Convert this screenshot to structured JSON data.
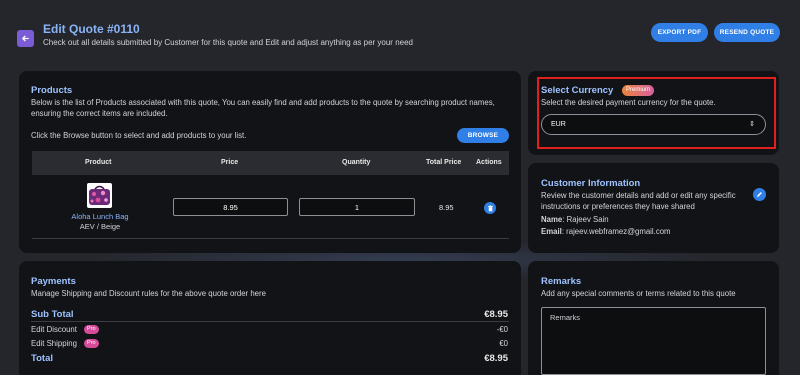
{
  "header": {
    "title": "Edit Quote #0110",
    "subtitle": "Check out all details submitted by Customer for this quote and Edit and adjust anything as per your need",
    "export_label": "EXPORT PDF",
    "resend_label": "RESEND QUOTE"
  },
  "products": {
    "title": "Products",
    "description": "Below is the list of Products associated with this quote, You can easily find and add products to the quote by searching product names, ensuring the correct items are included.",
    "browse_hint": "Click the Browse button to select and add products to your list.",
    "browse_label": "BROWSE",
    "columns": [
      "Product",
      "Price",
      "Quantity",
      "Total Price",
      "Actions"
    ],
    "rows": [
      {
        "name": "Aloha Lunch Bag",
        "variant": "AEV / Beige",
        "price": "8.95",
        "quantity": "1",
        "total": "8.95"
      }
    ]
  },
  "currency": {
    "title": "Select Currency",
    "badge": "Premium",
    "description": "Select the desired payment currency for the quote.",
    "selected": "EUR"
  },
  "customer": {
    "title": "Customer Information",
    "description": "Review the customer details and add or edit any specific instructions or preferences they have shared",
    "name_label": "Name",
    "name_value": ": Rajeev Sain",
    "email_label": "Email",
    "email_value": ": rajeev.webframez@gmail.com"
  },
  "payments": {
    "title": "Payments",
    "description": "Manage Shipping and Discount rules for the above quote order here",
    "subtotal_label": "Sub Total",
    "subtotal_value": "€8.95",
    "discount_label": "Edit Discount",
    "discount_value": "-€0",
    "shipping_label": "Edit Shipping",
    "shipping_value": "€0",
    "pro_badge": "Pro",
    "total_label": "Total",
    "total_value": "€8.95"
  },
  "remarks": {
    "title": "Remarks",
    "description": "Add any special comments or terms related to this quote",
    "placeholder": "Remarks"
  },
  "colors": {
    "accent": "#2f7fe6",
    "heading": "#9ec3ff",
    "highlight_frame": "#e0201c",
    "back_button": "#7b5cd6"
  },
  "icons": [
    "back-arrow-icon",
    "trash-icon",
    "pencil-icon",
    "chevron-updown-icon",
    "product-image"
  ]
}
